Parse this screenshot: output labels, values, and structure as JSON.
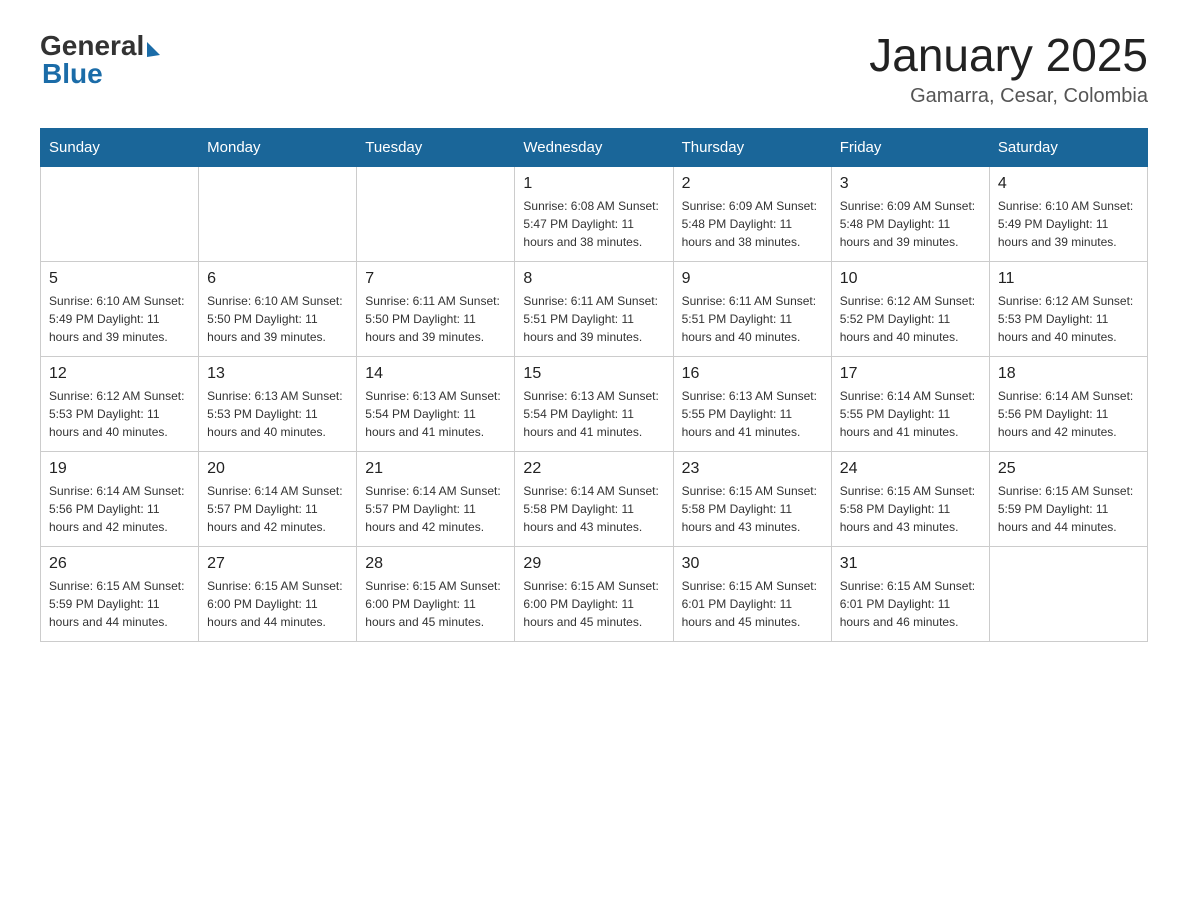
{
  "header": {
    "title": "January 2025",
    "subtitle": "Gamarra, Cesar, Colombia"
  },
  "logo": {
    "general": "General",
    "blue": "Blue"
  },
  "days": [
    "Sunday",
    "Monday",
    "Tuesday",
    "Wednesday",
    "Thursday",
    "Friday",
    "Saturday"
  ],
  "weeks": [
    [
      {
        "day": "",
        "info": ""
      },
      {
        "day": "",
        "info": ""
      },
      {
        "day": "",
        "info": ""
      },
      {
        "day": "1",
        "info": "Sunrise: 6:08 AM\nSunset: 5:47 PM\nDaylight: 11 hours\nand 38 minutes."
      },
      {
        "day": "2",
        "info": "Sunrise: 6:09 AM\nSunset: 5:48 PM\nDaylight: 11 hours\nand 38 minutes."
      },
      {
        "day": "3",
        "info": "Sunrise: 6:09 AM\nSunset: 5:48 PM\nDaylight: 11 hours\nand 39 minutes."
      },
      {
        "day": "4",
        "info": "Sunrise: 6:10 AM\nSunset: 5:49 PM\nDaylight: 11 hours\nand 39 minutes."
      }
    ],
    [
      {
        "day": "5",
        "info": "Sunrise: 6:10 AM\nSunset: 5:49 PM\nDaylight: 11 hours\nand 39 minutes."
      },
      {
        "day": "6",
        "info": "Sunrise: 6:10 AM\nSunset: 5:50 PM\nDaylight: 11 hours\nand 39 minutes."
      },
      {
        "day": "7",
        "info": "Sunrise: 6:11 AM\nSunset: 5:50 PM\nDaylight: 11 hours\nand 39 minutes."
      },
      {
        "day": "8",
        "info": "Sunrise: 6:11 AM\nSunset: 5:51 PM\nDaylight: 11 hours\nand 39 minutes."
      },
      {
        "day": "9",
        "info": "Sunrise: 6:11 AM\nSunset: 5:51 PM\nDaylight: 11 hours\nand 40 minutes."
      },
      {
        "day": "10",
        "info": "Sunrise: 6:12 AM\nSunset: 5:52 PM\nDaylight: 11 hours\nand 40 minutes."
      },
      {
        "day": "11",
        "info": "Sunrise: 6:12 AM\nSunset: 5:53 PM\nDaylight: 11 hours\nand 40 minutes."
      }
    ],
    [
      {
        "day": "12",
        "info": "Sunrise: 6:12 AM\nSunset: 5:53 PM\nDaylight: 11 hours\nand 40 minutes."
      },
      {
        "day": "13",
        "info": "Sunrise: 6:13 AM\nSunset: 5:53 PM\nDaylight: 11 hours\nand 40 minutes."
      },
      {
        "day": "14",
        "info": "Sunrise: 6:13 AM\nSunset: 5:54 PM\nDaylight: 11 hours\nand 41 minutes."
      },
      {
        "day": "15",
        "info": "Sunrise: 6:13 AM\nSunset: 5:54 PM\nDaylight: 11 hours\nand 41 minutes."
      },
      {
        "day": "16",
        "info": "Sunrise: 6:13 AM\nSunset: 5:55 PM\nDaylight: 11 hours\nand 41 minutes."
      },
      {
        "day": "17",
        "info": "Sunrise: 6:14 AM\nSunset: 5:55 PM\nDaylight: 11 hours\nand 41 minutes."
      },
      {
        "day": "18",
        "info": "Sunrise: 6:14 AM\nSunset: 5:56 PM\nDaylight: 11 hours\nand 42 minutes."
      }
    ],
    [
      {
        "day": "19",
        "info": "Sunrise: 6:14 AM\nSunset: 5:56 PM\nDaylight: 11 hours\nand 42 minutes."
      },
      {
        "day": "20",
        "info": "Sunrise: 6:14 AM\nSunset: 5:57 PM\nDaylight: 11 hours\nand 42 minutes."
      },
      {
        "day": "21",
        "info": "Sunrise: 6:14 AM\nSunset: 5:57 PM\nDaylight: 11 hours\nand 42 minutes."
      },
      {
        "day": "22",
        "info": "Sunrise: 6:14 AM\nSunset: 5:58 PM\nDaylight: 11 hours\nand 43 minutes."
      },
      {
        "day": "23",
        "info": "Sunrise: 6:15 AM\nSunset: 5:58 PM\nDaylight: 11 hours\nand 43 minutes."
      },
      {
        "day": "24",
        "info": "Sunrise: 6:15 AM\nSunset: 5:58 PM\nDaylight: 11 hours\nand 43 minutes."
      },
      {
        "day": "25",
        "info": "Sunrise: 6:15 AM\nSunset: 5:59 PM\nDaylight: 11 hours\nand 44 minutes."
      }
    ],
    [
      {
        "day": "26",
        "info": "Sunrise: 6:15 AM\nSunset: 5:59 PM\nDaylight: 11 hours\nand 44 minutes."
      },
      {
        "day": "27",
        "info": "Sunrise: 6:15 AM\nSunset: 6:00 PM\nDaylight: 11 hours\nand 44 minutes."
      },
      {
        "day": "28",
        "info": "Sunrise: 6:15 AM\nSunset: 6:00 PM\nDaylight: 11 hours\nand 45 minutes."
      },
      {
        "day": "29",
        "info": "Sunrise: 6:15 AM\nSunset: 6:00 PM\nDaylight: 11 hours\nand 45 minutes."
      },
      {
        "day": "30",
        "info": "Sunrise: 6:15 AM\nSunset: 6:01 PM\nDaylight: 11 hours\nand 45 minutes."
      },
      {
        "day": "31",
        "info": "Sunrise: 6:15 AM\nSunset: 6:01 PM\nDaylight: 11 hours\nand 46 minutes."
      },
      {
        "day": "",
        "info": ""
      }
    ]
  ]
}
